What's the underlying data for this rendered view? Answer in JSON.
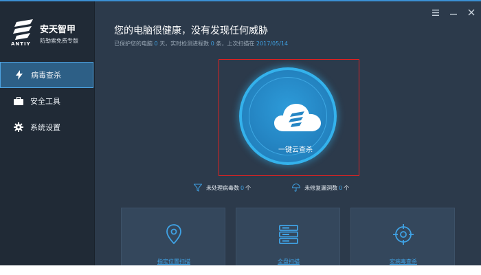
{
  "brand": {
    "name": "安天智甲",
    "english": "ANTIY",
    "subtitle": "防勒索免费专版"
  },
  "sidebar": {
    "items": [
      {
        "label": "病毒查杀",
        "icon": "lightning-icon",
        "active": true
      },
      {
        "label": "安全工具",
        "icon": "briefcase-icon",
        "active": false
      },
      {
        "label": "系统设置",
        "icon": "gear-icon",
        "active": false
      }
    ]
  },
  "window_controls": [
    "menu-icon",
    "minimize-icon",
    "close-icon"
  ],
  "status": {
    "headline": "您的电脑很健康，没有发现任何威胁",
    "protected_prefix": "已保护您的电脑",
    "protected_days": "0",
    "protected_suffix": "天，实时检测进程数",
    "process_count": "0",
    "process_suffix": "条，上次扫描在",
    "last_scan_date": "2017/05/14"
  },
  "scan_button": {
    "label": "一键云查杀",
    "icon": "cloud-icon"
  },
  "stats": [
    {
      "label": "未处理病毒数",
      "value": "0",
      "unit": "个",
      "icon": "filter-icon"
    },
    {
      "label": "未修复漏洞数",
      "value": "0",
      "unit": "个",
      "icon": "umbrella-icon"
    }
  ],
  "cards": [
    {
      "label": "指定位置扫描",
      "icon": "location-pin-icon"
    },
    {
      "label": "全盘扫描",
      "icon": "server-icon"
    },
    {
      "label": "宏病毒查杀",
      "icon": "crosshair-icon"
    }
  ],
  "colors": {
    "accent": "#3fa3e6",
    "sidebar_bg": "#202a36",
    "main_bg": "#2c3a4b",
    "highlight_border": "#e02121"
  }
}
